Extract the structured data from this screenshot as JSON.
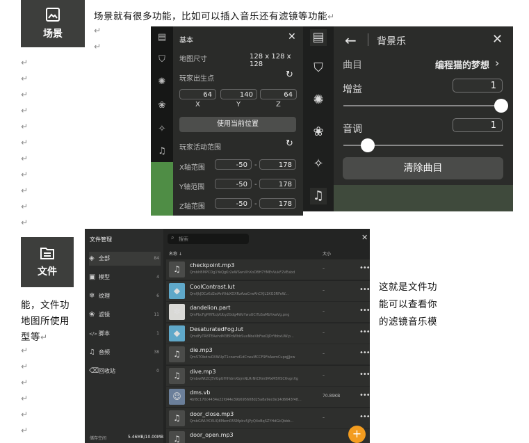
{
  "doc": {
    "line1": "场景就有很多功能，比如可以插入音乐还有滤镜等功能",
    "right_text": [
      "这就是文件功",
      "能可以查看你",
      "的滤镜音乐模"
    ],
    "left_text": [
      "能，文件功",
      "地图所使用",
      "型等"
    ],
    "return_mark": "↵"
  },
  "tiles": {
    "scene_label": "场景",
    "files_label": "文件"
  },
  "panel_basic": {
    "title": "基本",
    "map_size_label": "地图尺寸",
    "map_size_value": "128 x 128 x 128",
    "spawn_label": "玩家出生点",
    "spawn": {
      "x": "64",
      "y": "140",
      "z": "64"
    },
    "axis": {
      "x": "X",
      "y": "Y",
      "z": "Z"
    },
    "use_current_button": "使用当前位置",
    "activity_label": "玩家活动范围",
    "ranges": [
      {
        "label": "X轴范围",
        "min": "-50",
        "max": "178"
      },
      {
        "label": "Y轴范围",
        "min": "-50",
        "max": "178"
      },
      {
        "label": "Z轴范围",
        "min": "-50",
        "max": "178"
      }
    ],
    "dash": "-"
  },
  "panel_music": {
    "title": "背景乐",
    "track_label": "曲目",
    "track_value": "编程猫的梦想",
    "gain_label": "增益",
    "gain_value": "1",
    "gain_level": 1.0,
    "pitch_label": "音调",
    "pitch_value": "1",
    "pitch_level": 0.15,
    "clear_button": "清除曲目"
  },
  "file_manager": {
    "title": "文件管理",
    "search_placeholder": "搜索",
    "col_name": "名称 ↓",
    "col_size": "大小",
    "categories": [
      {
        "label": "全部",
        "count": "84",
        "icon": "grid-icon"
      },
      {
        "label": "模型",
        "count": "4",
        "icon": "image-icon"
      },
      {
        "label": "纹理",
        "count": "6",
        "icon": "snowflake-icon"
      },
      {
        "label": "滤镜",
        "count": "11",
        "icon": "filter-icon"
      },
      {
        "label": "脚本",
        "count": "1",
        "icon": "code-icon"
      },
      {
        "label": "音频",
        "count": "38",
        "icon": "music-icon"
      },
      {
        "label": "回收站",
        "count": "0",
        "icon": "trash-icon"
      }
    ],
    "storage_label": "储存空间",
    "storage_value": "5.46MB/10.00MB",
    "files": [
      {
        "name": "checkpoint.mp3",
        "hash": "QmbhBMPCDg1YeQgKr2eWSwnXhXoDBH7YMEvVukF2VEabd",
        "size": "–",
        "icon": "music-note-icon"
      },
      {
        "name": "CoolContrast.lut",
        "hash": "QmfjkJDCzKd2eiAnRhbXDXRzAzaCrwAhCXJL1KG3RFeW...",
        "size": "–",
        "icon": "lut-icon"
      },
      {
        "name": "dandelion.part",
        "hash": "QmPbcFgPiNTcqVUby2Gdg4WoYwuUCiTuSaMbYwaVg.png",
        "size": "–",
        "icon": "dandelion-icon"
      },
      {
        "name": "DesaturatedFog.lut",
        "hash": "QmdFyTR8TEAehdM3EPdWhbSuxNbeVbFseDjDrYbbxUW.p...",
        "size": "–",
        "icon": "lut-icon"
      },
      {
        "name": "die.mp3",
        "hash": "QmS7ObdruOXWUpT1czamd1dCrwuMCCF9FbAwmCupqjJJow",
        "size": "–",
        "icon": "music-note-icon"
      },
      {
        "name": "dive.mp3",
        "hash": "QmbwWt2CJ5VGpUfHHdmXbjmNLRrNtCNm9MxM5HSC6vgnXg",
        "size": "–",
        "icon": "music-note-icon"
      },
      {
        "name": "dms.vb",
        "hash": "4bf8c170c4434e22fd44e39b695608d25a8a9ec0e14d6643f48...",
        "size": "70.89KB",
        "icon": "avatar-icon"
      },
      {
        "name": "door_close.mp3",
        "hash": "QmbGWUYC6UQ8MemR5SMpbv5jPyQ4oBqSZYHdGkQbbb...",
        "size": "–",
        "icon": "music-note-icon"
      },
      {
        "name": "door_open.mp3",
        "hash": "",
        "size": "",
        "icon": "music-note-icon"
      }
    ],
    "fab_label": "+",
    "more": "•••"
  },
  "colors": {
    "accent_orange": "#f39c1f",
    "panel_dark": "#2b2c2a"
  }
}
